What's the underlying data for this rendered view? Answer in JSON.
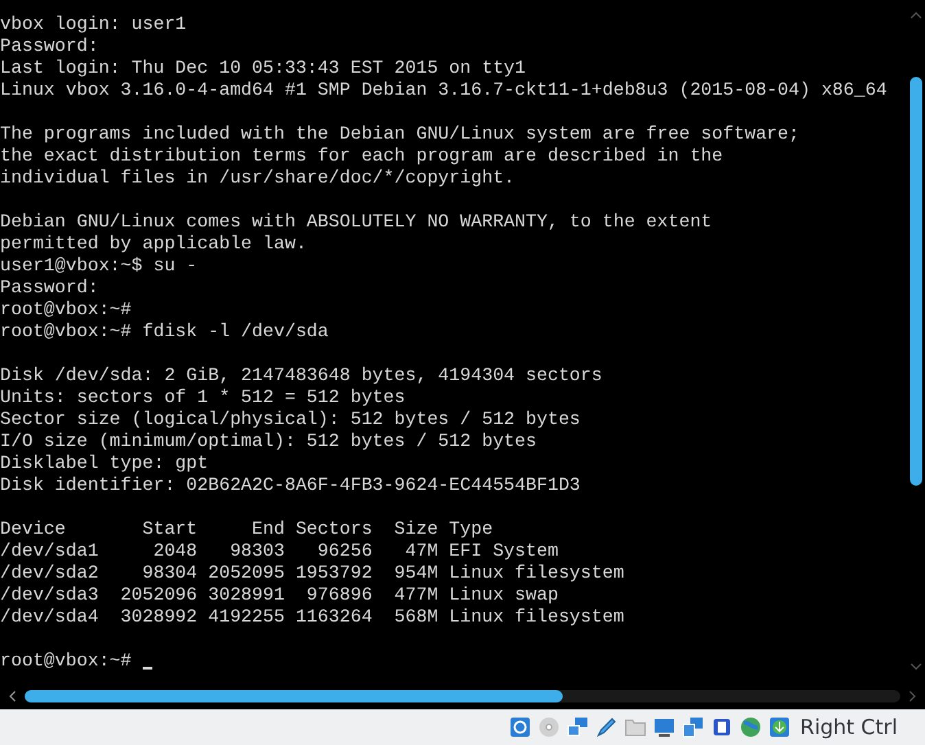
{
  "console": {
    "blocks": [
      [
        "vbox login: user1",
        "Password:",
        "Last login: Thu Dec 10 05:33:43 EST 2015 on tty1",
        "Linux vbox 3.16.0-4-amd64 #1 SMP Debian 3.16.7-ckt11-1+deb8u3 (2015-08-04) x86_64"
      ],
      [
        "The programs included with the Debian GNU/Linux system are free software;",
        "the exact distribution terms for each program are described in the",
        "individual files in /usr/share/doc/*/copyright."
      ],
      [
        "Debian GNU/Linux comes with ABSOLUTELY NO WARRANTY, to the extent",
        "permitted by applicable law.",
        "user1@vbox:~$ su -",
        "Password:",
        "root@vbox:~#",
        "root@vbox:~# fdisk -l /dev/sda"
      ],
      [
        "Disk /dev/sda: 2 GiB, 2147483648 bytes, 4194304 sectors",
        "Units: sectors of 1 * 512 = 512 bytes",
        "Sector size (logical/physical): 512 bytes / 512 bytes",
        "I/O size (minimum/optimal): 512 bytes / 512 bytes",
        "Disklabel type: gpt",
        "Disk identifier: 02B62A2C-8A6F-4FB3-9624-EC44554BF1D3"
      ],
      [
        "Device       Start     End Sectors  Size Type",
        "/dev/sda1     2048   98303   96256   47M EFI System",
        "/dev/sda2    98304 2052095 1953792  954M Linux filesystem",
        "/dev/sda3  2052096 3028991  976896  477M Linux swap",
        "/dev/sda4  3028992 4192255 1163264  568M Linux filesystem"
      ]
    ],
    "prompt": "root@vbox:~#"
  },
  "status_bar": {
    "host_key": "Right Ctrl"
  }
}
